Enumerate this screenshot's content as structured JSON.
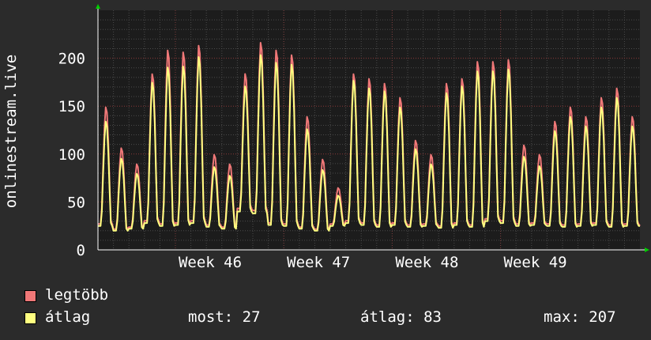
{
  "chart_data": {
    "type": "line",
    "ylabel": "onlinestream.live",
    "ylim": [
      0,
      250
    ],
    "yticks": [
      0,
      50,
      100,
      150,
      200
    ],
    "xlim": [
      0,
      35
    ],
    "xticks": [
      {
        "label": "Week 46",
        "value": 5
      },
      {
        "label": "Week 47",
        "value": 12
      },
      {
        "label": "Week 48",
        "value": 19
      },
      {
        "label": "Week 49",
        "value": 26
      }
    ],
    "grid": true,
    "colors": {
      "background": "#2b2b2b",
      "plot": "#1c1c1c",
      "grid": "#4a4a4a",
      "vgrid_major": "#7a3a3a",
      "axis": "#ffffff",
      "arrow": "#00cc00"
    },
    "series": [
      {
        "name": "legtöbb",
        "color": "#f07878",
        "daily_peaks": [
          150,
          107,
          90,
          185,
          210,
          208,
          215,
          100,
          90,
          185,
          218,
          210,
          205,
          140,
          95,
          65,
          185,
          180,
          175,
          160,
          115,
          100,
          175,
          180,
          198,
          198,
          200,
          110,
          100,
          135,
          150,
          140,
          160,
          170,
          140
        ]
      },
      {
        "name": "átlag",
        "color": "#ffff80",
        "daily_peaks": [
          135,
          96,
          80,
          176,
          192,
          193,
          203,
          87,
          78,
          172,
          205,
          197,
          195,
          127,
          84,
          57,
          178,
          170,
          167,
          150,
          106,
          90,
          165,
          172,
          188,
          188,
          190,
          98,
          88,
          125,
          140,
          130,
          150,
          160,
          130
        ],
        "daily_mins": [
          25,
          20,
          22,
          28,
          25,
          26,
          28,
          24,
          22,
          40,
          38,
          26,
          25,
          22,
          20,
          25,
          28,
          26,
          24,
          26,
          24,
          25,
          23,
          26,
          24,
          30,
          28,
          25,
          26,
          25,
          24,
          25,
          26,
          24,
          25
        ]
      }
    ]
  },
  "legend": [
    {
      "label": "legtöbb",
      "color": "#f07878"
    },
    {
      "label": "átlag",
      "color": "#ffff80"
    }
  ],
  "stats": {
    "now": "most: 27",
    "avg": "átlag: 83",
    "max": "max: 207"
  }
}
